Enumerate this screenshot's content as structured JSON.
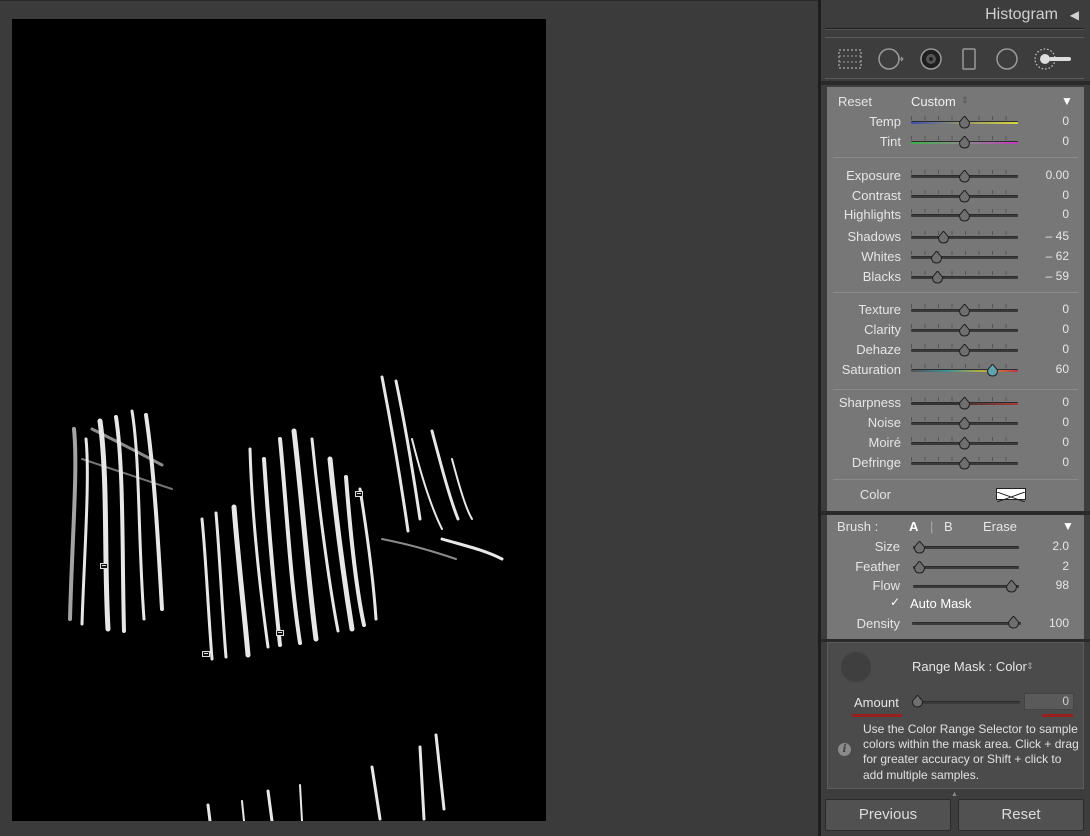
{
  "panel": {
    "title": "Histogram",
    "collapse_glyph": "◀",
    "tools": [
      {
        "name": "graduated-filter-icon"
      },
      {
        "name": "spot-removal-icon"
      },
      {
        "name": "red-eye-icon"
      },
      {
        "name": "crop-icon"
      },
      {
        "name": "radial-filter-icon"
      },
      {
        "name": "adjustment-brush-icon"
      }
    ]
  },
  "adjust": {
    "reset_label": "Reset",
    "preset_value": "Custom",
    "preset_arrows": "⇕",
    "collapse_glyph": "▼",
    "sliders": [
      {
        "label": "Temp",
        "value": "0",
        "pos": 0.5
      },
      {
        "label": "Tint",
        "value": "0",
        "pos": 0.5
      },
      {
        "label": "Exposure",
        "value": "0.00",
        "pos": 0.5
      },
      {
        "label": "Contrast",
        "value": "0",
        "pos": 0.5
      },
      {
        "label": "Highlights",
        "value": "0",
        "pos": 0.5
      },
      {
        "label": "Shadows",
        "value": "– 45",
        "pos": 0.305
      },
      {
        "label": "Whites",
        "value": "– 62",
        "pos": 0.235
      },
      {
        "label": "Blacks",
        "value": "– 59",
        "pos": 0.245
      },
      {
        "label": "Texture",
        "value": "0",
        "pos": 0.5
      },
      {
        "label": "Clarity",
        "value": "0",
        "pos": 0.5
      },
      {
        "label": "Dehaze",
        "value": "0",
        "pos": 0.5
      },
      {
        "label": "Saturation",
        "value": "60",
        "pos": 0.76
      },
      {
        "label": "Sharpness",
        "value": "0",
        "pos": 0.5
      },
      {
        "label": "Noise",
        "value": "0",
        "pos": 0.5
      },
      {
        "label": "Moiré",
        "value": "0",
        "pos": 0.5
      },
      {
        "label": "Defringe",
        "value": "0",
        "pos": 0.5
      }
    ],
    "color_label": "Color"
  },
  "brush": {
    "label": "Brush :",
    "tab_a": "A",
    "tab_b": "B",
    "tab_erase": "Erase",
    "collapse_glyph": "▼",
    "sliders": [
      {
        "label": "Size",
        "value": "2.0",
        "pos": 0.06
      },
      {
        "label": "Feather",
        "value": "2",
        "pos": 0.06
      },
      {
        "label": "Flow",
        "value": "98",
        "pos": 0.93
      }
    ],
    "auto_mask_check": "✓",
    "auto_mask_label": "Auto Mask",
    "density": {
      "label": "Density",
      "value": "100",
      "pos": 0.95
    }
  },
  "range_mask": {
    "label": "Range Mask : Color",
    "arrows": "⇕",
    "amount_label": "Amount",
    "amount_value": "0",
    "info_glyph": "i",
    "info_text": "Use the Color Range Selector to sample colors within the mask area. Click + drag for greater accuracy or Shift + click to add multiple samples."
  },
  "footer": {
    "previous_label": "Previous",
    "reset_label": "Reset",
    "chevron": "▲"
  }
}
